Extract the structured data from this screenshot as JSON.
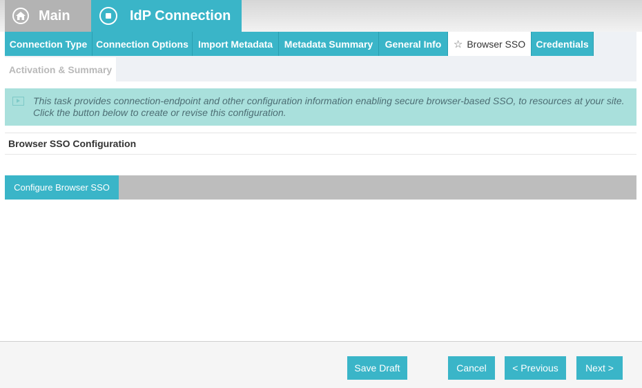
{
  "header": {
    "main_label": "Main",
    "idp_label": "IdP Connection"
  },
  "tabs": [
    {
      "label": "Connection Type"
    },
    {
      "label": "Connection Options"
    },
    {
      "label": "Import Metadata"
    },
    {
      "label": "Metadata Summary"
    },
    {
      "label": "General Info"
    },
    {
      "label": "Browser SSO",
      "active": true
    },
    {
      "label": "Credentials"
    },
    {
      "label": "Activation & Summary",
      "disabled": true
    }
  ],
  "info": {
    "text": "This task provides connection-endpoint and other configuration information enabling secure browser-based SSO, to resources at your site. Click the button below to create or revise this configuration."
  },
  "section": {
    "title": "Browser SSO Configuration"
  },
  "config": {
    "button_label": "Configure Browser SSO"
  },
  "footer": {
    "save_draft": "Save Draft",
    "cancel": "Cancel",
    "previous": "< Previous",
    "next": "Next >"
  },
  "colors": {
    "accent": "#3ab5c8",
    "info_bg": "#a9e0dc",
    "inactive_tab": "#b3b3b3"
  }
}
